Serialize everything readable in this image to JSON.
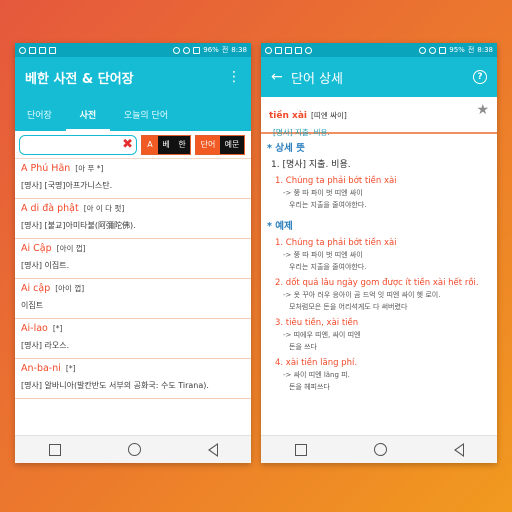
{
  "colors": {
    "accent": "#16bcd4",
    "statusbar": "#0aa5bd",
    "headword": "#f04a2a",
    "segment_on": "#f15a22",
    "section": "#2a7fbf"
  },
  "left": {
    "status": {
      "battery": "96%",
      "carrier": "전",
      "time": "8:38"
    },
    "app_title": "베한 사전 & 단어장",
    "tabs": [
      {
        "label": "단어장"
      },
      {
        "label": "사전"
      },
      {
        "label": "오늘의 단어"
      }
    ],
    "search": {
      "value": "",
      "placeholder": ""
    },
    "lang_toggle": {
      "a": "A",
      "b": "베",
      "c": "한"
    },
    "mode_toggle": {
      "a": "단어",
      "b": "예문"
    },
    "entries": [
      {
        "word": "A Phú Hãn",
        "pron": "[아 푸 *]",
        "meaning": "[명사] [국명]아프가니스탄."
      },
      {
        "word": "A di đà phật",
        "pron": "[아 이 다 펏]",
        "meaning": "[명사] [불교]아미타불(阿彌陀佛)."
      },
      {
        "word": "Ai Cập",
        "pron": "[아이 껍]",
        "meaning": "[명사] 이집트."
      },
      {
        "word": "Ai cập",
        "pron": "[아이 껍]",
        "meaning": "이집트"
      },
      {
        "word": "Ai-lao",
        "pron": "[*]",
        "meaning": "[명사] 라오스."
      },
      {
        "word": "An-ba-ni",
        "pron": "[*]",
        "meaning": "[명사] 알바니아(발칸반도 서부의 공화국: 수도 Tirana)."
      }
    ]
  },
  "right": {
    "status": {
      "battery": "95%",
      "carrier": "전",
      "time": "8:38"
    },
    "app_title": "단어 상세",
    "entry": {
      "word": "tiền xài",
      "pron": "[띠엔 싸이]",
      "meaning": "[명사] 지출. 비용."
    },
    "sections": {
      "meaning_title": "* 상세 뜻",
      "definition": "1. [명사] 지출. 비용.",
      "example_title": "* 예제"
    },
    "meaning_examples": [
      {
        "src": "1. Chúng ta phải bớt tiền xài",
        "pron": "-> 쭝 따 파이 벗 띠엔 싸이",
        "ko": "우리는 지출을 줄여야한다."
      }
    ],
    "examples": [
      {
        "src": "1. Chúng ta phải bớt tiền xài",
        "pron": "-> 쭝 따 파이 벗 띠엔 싸이",
        "ko": "우리는 지출을 줄여야한다."
      },
      {
        "src": "2. dốt quá lâu ngày gom được ít tiền xài hết rồi.",
        "pron": "-> 옷 꾸아 러우 응아이 곰 드억 잇 띠엔 싸이 헷 로이.",
        "ko": "모처럼모은 돈을 어리석게도 다 써버렸다"
      },
      {
        "src": "3. tiêu tiền, xài tiền",
        "pron": "-> 띠에우 띠엔, 싸이 띠엔",
        "ko": "돈을 쓰다"
      },
      {
        "src": "4. xài tiền lãng phí.",
        "pron": "-> 싸이 띠엔 lãng 피.",
        "ko": "돈을 헤피쓰다"
      }
    ]
  }
}
